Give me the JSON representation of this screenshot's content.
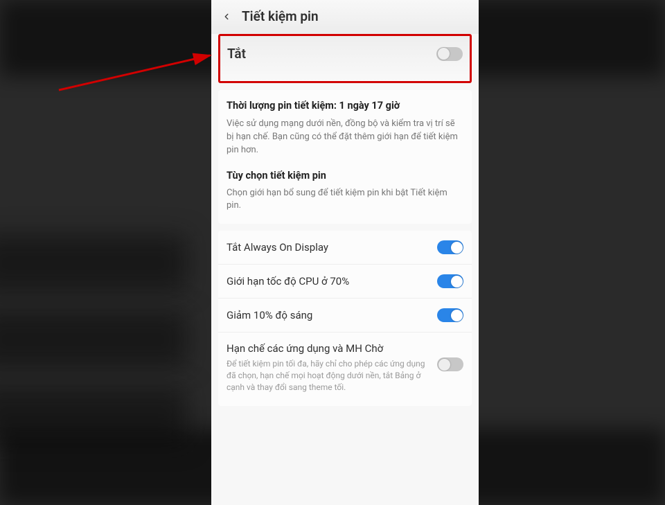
{
  "header": {
    "title": "Tiết kiệm pin"
  },
  "main_toggle": {
    "label": "Tắt",
    "state": "off"
  },
  "estimate": {
    "text": "Thời lượng pin tiết kiệm: 1 ngày 17 giờ",
    "description": "Việc sử dụng mạng dưới nền, đồng bộ và kiểm tra vị trí sẽ bị hạn chế. Bạn cũng có thể đặt thêm giới hạn để tiết kiệm pin hơn."
  },
  "options_section": {
    "title": "Tùy chọn tiết kiệm pin",
    "description": "Chọn giới hạn bổ sung để tiết kiệm pin khi bật Tiết kiệm pin."
  },
  "options": [
    {
      "label": "Tắt Always On Display",
      "on": true
    },
    {
      "label": "Giới hạn tốc độ CPU ở 70%",
      "on": true
    },
    {
      "label": "Giảm 10% độ sáng",
      "on": true
    },
    {
      "label": "Hạn chế các ứng dụng và MH Chờ",
      "sub": "Để tiết kiệm pin tối đa, hãy chỉ cho phép các ứng dụng đã chọn, hạn chế mọi hoạt động dưới nền, tắt Bảng ở cạnh và thay đổi sang theme tối.",
      "on": false
    }
  ],
  "annotation": {
    "highlight_color": "#d10000"
  }
}
